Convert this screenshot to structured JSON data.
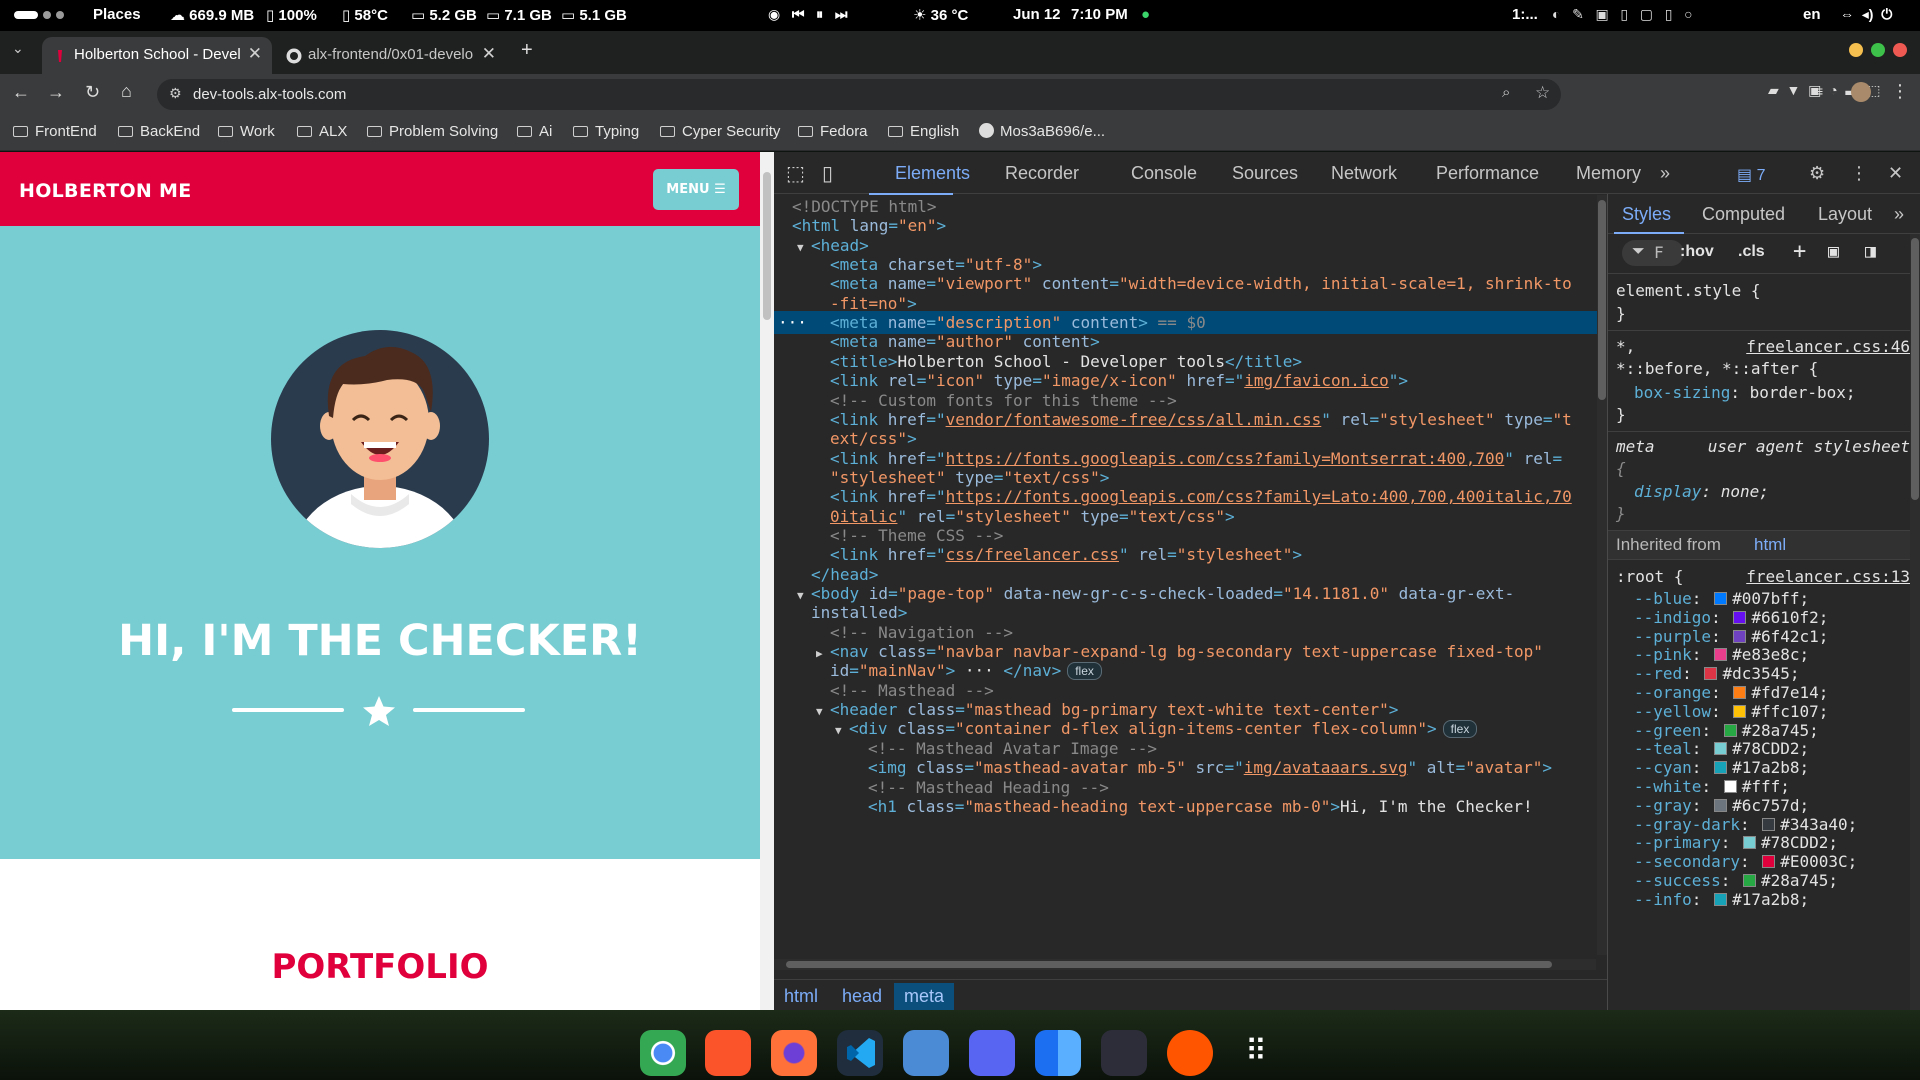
{
  "topbar": {
    "activities": "Places",
    "net": "669.9 MB",
    "battery": "100%",
    "temp_cpu": "58°C",
    "mem1": "5.2 GB",
    "mem2": "7.1 GB",
    "mem3": "5.1 GB",
    "weather": "36 °C",
    "date": "Jun 12",
    "time": "7:10 PM",
    "workspace": "1:...",
    "lang": "en"
  },
  "browser": {
    "tabs": [
      {
        "label": "Holberton School - Devel",
        "active": true
      },
      {
        "label": "alx-frontend/0x01-develo",
        "active": false
      }
    ],
    "url": "dev-tools.alx-tools.com",
    "bookmarks": [
      "FrontEnd",
      "BackEnd",
      "Work",
      "ALX",
      "Problem Solving",
      "Ai",
      "Typing",
      "Cyper Security",
      "Fedora",
      "English",
      "Mos3aB696/e..."
    ]
  },
  "page": {
    "brand": "HOLBERTON ME",
    "menu": "MENU",
    "heading": "HI, I'M THE CHECKER!",
    "section": "PORTFOLIO"
  },
  "devtools": {
    "tabs": [
      "Elements",
      "Recorder",
      "Console",
      "Sources",
      "Network",
      "Performance",
      "Memory"
    ],
    "issues": "7",
    "breadcrumbs": [
      "html",
      "head",
      "meta"
    ],
    "styles_tabs": [
      "Styles",
      "Computed",
      "Layout"
    ],
    "filter": "F",
    "hov": ":hov",
    "cls": ".cls",
    "rules": {
      "element": "element.style {",
      "close": "}",
      "universal_sel1": "*,",
      "universal_sel2": "*::before, *::after {",
      "universal_src": "freelancer.css:46",
      "box_prop": "box-sizing",
      "box_val": "border-box;",
      "meta_sel": "meta",
      "meta_src": "user agent stylesheet",
      "open": "{",
      "display_prop": "display",
      "display_val": "none;",
      "inherited": "Inherited from",
      "inherited_el": "html",
      "root_sel": ":root {",
      "root_src": "freelancer.css:13"
    },
    "root_vars": [
      {
        "name": "--blue",
        "value": "#007bff",
        "color": "#007bff"
      },
      {
        "name": "--indigo",
        "value": "#6610f2",
        "color": "#6610f2"
      },
      {
        "name": "--purple",
        "value": "#6f42c1",
        "color": "#6f42c1"
      },
      {
        "name": "--pink",
        "value": "#e83e8c",
        "color": "#e83e8c"
      },
      {
        "name": "--red",
        "value": "#dc3545",
        "color": "#dc3545"
      },
      {
        "name": "--orange",
        "value": "#fd7e14",
        "color": "#fd7e14"
      },
      {
        "name": "--yellow",
        "value": "#ffc107",
        "color": "#ffc107"
      },
      {
        "name": "--green",
        "value": "#28a745",
        "color": "#28a745"
      },
      {
        "name": "--teal",
        "value": "#78CDD2",
        "color": "#78CDD2"
      },
      {
        "name": "--cyan",
        "value": "#17a2b8",
        "color": "#17a2b8"
      },
      {
        "name": "--white",
        "value": "#fff",
        "color": "#ffffff"
      },
      {
        "name": "--gray",
        "value": "#6c757d",
        "color": "#6c757d"
      },
      {
        "name": "--gray-dark",
        "value": "#343a40",
        "color": "#343a40"
      },
      {
        "name": "--primary",
        "value": "#78CDD2",
        "color": "#78CDD2"
      },
      {
        "name": "--secondary",
        "value": "#E0003C",
        "color": "#E0003C"
      },
      {
        "name": "--success",
        "value": "#28a745",
        "color": "#28a745"
      },
      {
        "name": "--info",
        "value": "#17a2b8",
        "color": "#17a2b8"
      }
    ],
    "dom": [
      {
        "indent": 0,
        "parts": [
          [
            "cm",
            "<!DOCTYPE html>"
          ]
        ]
      },
      {
        "indent": 0,
        "parts": [
          [
            "tg",
            "<html "
          ],
          [
            "an",
            "lang"
          ],
          [
            "tg",
            "="
          ],
          [
            "av",
            "\"en\""
          ],
          [
            "tg",
            ">"
          ]
        ]
      },
      {
        "indent": 1,
        "tri": "▼",
        "parts": [
          [
            "tg",
            "<head>"
          ]
        ]
      },
      {
        "indent": 2,
        "parts": [
          [
            "tg",
            "<meta "
          ],
          [
            "an",
            "charset"
          ],
          [
            "tg",
            "="
          ],
          [
            "av",
            "\"utf-8\""
          ],
          [
            "tg",
            ">"
          ]
        ]
      },
      {
        "indent": 2,
        "parts": [
          [
            "tg",
            "<meta "
          ],
          [
            "an",
            "name"
          ],
          [
            "tg",
            "="
          ],
          [
            "av",
            "\"viewport\""
          ],
          [
            "an",
            " content"
          ],
          [
            "tg",
            "="
          ],
          [
            "av",
            "\"width=device-width, initial-scale=1, shrink-to"
          ]
        ]
      },
      {
        "indent": 2,
        "parts": [
          [
            "av",
            "-fit=no\""
          ],
          [
            "tg",
            ">"
          ]
        ]
      },
      {
        "indent": 2,
        "sel": true,
        "parts": [
          [
            "tg",
            "<meta "
          ],
          [
            "an",
            "name"
          ],
          [
            "tg",
            "="
          ],
          [
            "av",
            "\"description\""
          ],
          [
            "an",
            " content"
          ],
          [
            "tg",
            ">"
          ],
          [
            "cm",
            " == $0"
          ]
        ]
      },
      {
        "indent": 2,
        "parts": [
          [
            "tg",
            "<meta "
          ],
          [
            "an",
            "name"
          ],
          [
            "tg",
            "="
          ],
          [
            "av",
            "\"author\""
          ],
          [
            "an",
            " content"
          ],
          [
            "tg",
            ">"
          ]
        ]
      },
      {
        "indent": 2,
        "parts": [
          [
            "tg",
            "<title>"
          ],
          [
            "tx",
            "Holberton School - Developer tools"
          ],
          [
            "tg",
            "</title>"
          ]
        ]
      },
      {
        "indent": 2,
        "parts": [
          [
            "tg",
            "<link "
          ],
          [
            "an",
            "rel"
          ],
          [
            "tg",
            "="
          ],
          [
            "av",
            "\"icon\""
          ],
          [
            "an",
            " type"
          ],
          [
            "tg",
            "="
          ],
          [
            "av",
            "\"image/x-icon\""
          ],
          [
            "an",
            " href"
          ],
          [
            "tg",
            "=\""
          ],
          [
            "lk",
            "img/favicon.ico"
          ],
          [
            "tg",
            "\">"
          ]
        ]
      },
      {
        "indent": 2,
        "parts": [
          [
            "cm",
            "<!-- Custom fonts for this theme -->"
          ]
        ]
      },
      {
        "indent": 2,
        "parts": [
          [
            "tg",
            "<link "
          ],
          [
            "an",
            "href"
          ],
          [
            "tg",
            "=\""
          ],
          [
            "lk",
            "vendor/fontawesome-free/css/all.min.css"
          ],
          [
            "tg",
            "\""
          ],
          [
            "an",
            " rel"
          ],
          [
            "tg",
            "="
          ],
          [
            "av",
            "\"stylesheet\""
          ],
          [
            "an",
            " type"
          ],
          [
            "tg",
            "="
          ],
          [
            "av",
            "\"t"
          ]
        ]
      },
      {
        "indent": 2,
        "parts": [
          [
            "av",
            "ext/css\""
          ],
          [
            "tg",
            ">"
          ]
        ]
      },
      {
        "indent": 2,
        "parts": [
          [
            "tg",
            "<link "
          ],
          [
            "an",
            "href"
          ],
          [
            "tg",
            "=\""
          ],
          [
            "lk",
            "https://fonts.googleapis.com/css?family=Montserrat:400,700"
          ],
          [
            "tg",
            "\""
          ],
          [
            "an",
            " rel"
          ],
          [
            "tg",
            "="
          ]
        ]
      },
      {
        "indent": 2,
        "parts": [
          [
            "av",
            "\"stylesheet\""
          ],
          [
            "an",
            " type"
          ],
          [
            "tg",
            "="
          ],
          [
            "av",
            "\"text/css\""
          ],
          [
            "tg",
            ">"
          ]
        ]
      },
      {
        "indent": 2,
        "parts": [
          [
            "tg",
            "<link "
          ],
          [
            "an",
            "href"
          ],
          [
            "tg",
            "=\""
          ],
          [
            "lk",
            "https://fonts.googleapis.com/css?family=Lato:400,700,400italic,70"
          ]
        ]
      },
      {
        "indent": 2,
        "parts": [
          [
            "lk",
            "0italic"
          ],
          [
            "tg",
            "\""
          ],
          [
            "an",
            " rel"
          ],
          [
            "tg",
            "="
          ],
          [
            "av",
            "\"stylesheet\""
          ],
          [
            "an",
            " type"
          ],
          [
            "tg",
            "="
          ],
          [
            "av",
            "\"text/css\""
          ],
          [
            "tg",
            ">"
          ]
        ]
      },
      {
        "indent": 2,
        "parts": [
          [
            "cm",
            "<!-- Theme CSS -->"
          ]
        ]
      },
      {
        "indent": 2,
        "parts": [
          [
            "tg",
            "<link "
          ],
          [
            "an",
            "href"
          ],
          [
            "tg",
            "=\""
          ],
          [
            "lk",
            "css/freelancer.css"
          ],
          [
            "tg",
            "\""
          ],
          [
            "an",
            " rel"
          ],
          [
            "tg",
            "="
          ],
          [
            "av",
            "\"stylesheet\""
          ],
          [
            "tg",
            ">"
          ]
        ]
      },
      {
        "indent": 1,
        "parts": [
          [
            "tg",
            "</head>"
          ]
        ]
      },
      {
        "indent": 1,
        "tri": "▼",
        "parts": [
          [
            "tg",
            "<body "
          ],
          [
            "an",
            "id"
          ],
          [
            "tg",
            "="
          ],
          [
            "av",
            "\"page-top\""
          ],
          [
            "an",
            " data-new-gr-c-s-check-loaded"
          ],
          [
            "tg",
            "="
          ],
          [
            "av",
            "\"14.1181.0\""
          ],
          [
            "an",
            " data-gr-ext-"
          ]
        ]
      },
      {
        "indent": 1,
        "parts": [
          [
            "an",
            "installed"
          ],
          [
            "tg",
            ">"
          ]
        ]
      },
      {
        "indent": 2,
        "parts": [
          [
            "cm",
            "<!-- Navigation -->"
          ]
        ]
      },
      {
        "indent": 2,
        "tri": "▶",
        "parts": [
          [
            "tg",
            "<nav "
          ],
          [
            "an",
            "class"
          ],
          [
            "tg",
            "="
          ],
          [
            "av",
            "\"navbar navbar-expand-lg bg-secondary text-uppercase fixed-top\""
          ]
        ]
      },
      {
        "indent": 2,
        "parts": [
          [
            "an",
            "id"
          ],
          [
            "tg",
            "="
          ],
          [
            "av",
            "\"mainNav\""
          ],
          [
            "tg",
            ">"
          ],
          [
            "tx",
            " ··· "
          ],
          [
            "tg",
            "</nav>"
          ]
        ],
        "badge": "flex"
      },
      {
        "indent": 2,
        "parts": [
          [
            "cm",
            "<!-- Masthead -->"
          ]
        ]
      },
      {
        "indent": 2,
        "tri": "▼",
        "parts": [
          [
            "tg",
            "<header "
          ],
          [
            "an",
            "class"
          ],
          [
            "tg",
            "="
          ],
          [
            "av",
            "\"masthead bg-primary text-white text-center\""
          ],
          [
            "tg",
            ">"
          ]
        ]
      },
      {
        "indent": 3,
        "tri": "▼",
        "parts": [
          [
            "tg",
            "<div "
          ],
          [
            "an",
            "class"
          ],
          [
            "tg",
            "="
          ],
          [
            "av",
            "\"container d-flex align-items-center flex-column\""
          ],
          [
            "tg",
            ">"
          ]
        ],
        "badge": "flex"
      },
      {
        "indent": 4,
        "parts": [
          [
            "cm",
            "<!-- Masthead Avatar Image -->"
          ]
        ]
      },
      {
        "indent": 4,
        "parts": [
          [
            "tg",
            "<img "
          ],
          [
            "an",
            "class"
          ],
          [
            "tg",
            "="
          ],
          [
            "av",
            "\"masthead-avatar mb-5\""
          ],
          [
            "an",
            " src"
          ],
          [
            "tg",
            "=\""
          ],
          [
            "lk",
            "img/avataaars.svg"
          ],
          [
            "tg",
            "\""
          ],
          [
            "an",
            " alt"
          ],
          [
            "tg",
            "="
          ],
          [
            "av",
            "\"avatar\""
          ],
          [
            "tg",
            ">"
          ]
        ]
      },
      {
        "indent": 4,
        "parts": [
          [
            "cm",
            "<!-- Masthead Heading -->"
          ]
        ]
      },
      {
        "indent": 4,
        "parts": [
          [
            "tg",
            "<h1 "
          ],
          [
            "an",
            "class"
          ],
          [
            "tg",
            "="
          ],
          [
            "av",
            "\"masthead-heading text-uppercase mb-0\""
          ],
          [
            "tg",
            ">"
          ],
          [
            "tx",
            "Hi, I'm the Checker!"
          ]
        ]
      }
    ]
  },
  "dock": [
    "chrome",
    "brave",
    "firefox",
    "vscode",
    "github-desktop",
    "discord",
    "finder",
    "jetbrains",
    "soundcloud",
    "app-grid"
  ]
}
